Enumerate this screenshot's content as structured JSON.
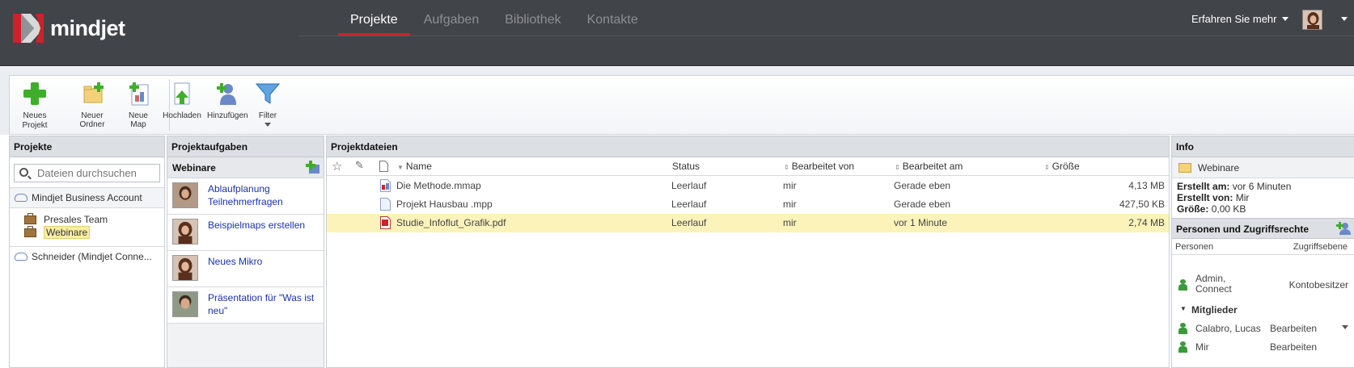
{
  "brand": {
    "name": "mindjet",
    "accent": "#cc2229",
    "bar_bg": "#414449"
  },
  "nav": {
    "tabs": [
      {
        "label": "Projekte",
        "active": true
      },
      {
        "label": "Aufgaben",
        "active": false
      },
      {
        "label": "Bibliothek",
        "active": false
      },
      {
        "label": "Kontakte",
        "active": false
      }
    ],
    "learn_more": "Erfahren Sie mehr"
  },
  "toolbar": {
    "neues_projekt": "Neues Projekt",
    "neuer_ordner": "Neuer Ordner",
    "neue_map": "Neue Map",
    "hochladen": "Hochladen",
    "hinzufuegen": "Hinzufügen",
    "filter": "Filter"
  },
  "projekte": {
    "title": "Projekte",
    "search_placeholder": "Dateien durchsuchen",
    "account": "Mindjet Business Account",
    "items": [
      "Presales Team",
      "Webinare"
    ],
    "selected": "Webinare",
    "account2": "Schneider (Mindjet Conne..."
  },
  "aufgaben": {
    "title": "Projektaufgaben",
    "group": "Webinare",
    "tasks": [
      {
        "title": "Ablaufplanung Teilnehmerfragen",
        "icon": "person-avatar"
      },
      {
        "title": "Beispielmaps erstellen",
        "icon": "person-avatar"
      },
      {
        "title": "Neues Mikro",
        "icon": "person-avatar"
      },
      {
        "title": "Präsentation für \"Was ist neu\"",
        "icon": "person-avatar"
      }
    ]
  },
  "dateien": {
    "title": "Projektdateien",
    "columns": {
      "name": "Name",
      "status": "Status",
      "bearbeitet_von": "Bearbeitet von",
      "bearbeitet_am": "Bearbeitet am",
      "groesse": "Größe"
    },
    "rows": [
      {
        "name": "Die Methode.mmap",
        "status": "Leerlauf",
        "von": "mir",
        "am": "Gerade eben",
        "groesse": "4,13 MB",
        "icon": "mindmap-icon",
        "selected": false
      },
      {
        "name": "Projekt Hausbau .mpp",
        "status": "Leerlauf",
        "von": "mir",
        "am": "Gerade eben",
        "groesse": "427,50 KB",
        "icon": "document-icon",
        "selected": false
      },
      {
        "name": "Studie_Infoflut_Grafik.pdf",
        "status": "Leerlauf",
        "von": "mir",
        "am": "vor 1 Minute",
        "groesse": "2,74 MB",
        "icon": "pdf-icon",
        "selected": true
      }
    ]
  },
  "info": {
    "title": "Info",
    "folder": "Webinare",
    "erstellt_am_label": "Erstellt am:",
    "erstellt_am": "vor 6 Minuten",
    "erstellt_von_label": "Erstellt von:",
    "erstellt_von": "Mir",
    "groesse_label": "Größe:",
    "groesse": "0,00 KB",
    "access_title": "Personen und Zugriffsrechte",
    "col_personen": "Personen",
    "col_zugriff": "Zugriffsebene",
    "owner_name": "Admin, Connect",
    "owner_access": "Kontobesitzer",
    "members_label": "Mitglieder",
    "members": [
      {
        "name": "Calabro, Lucas",
        "access": "Bearbeiten"
      },
      {
        "name": "Mir",
        "access": "Bearbeiten"
      }
    ]
  }
}
